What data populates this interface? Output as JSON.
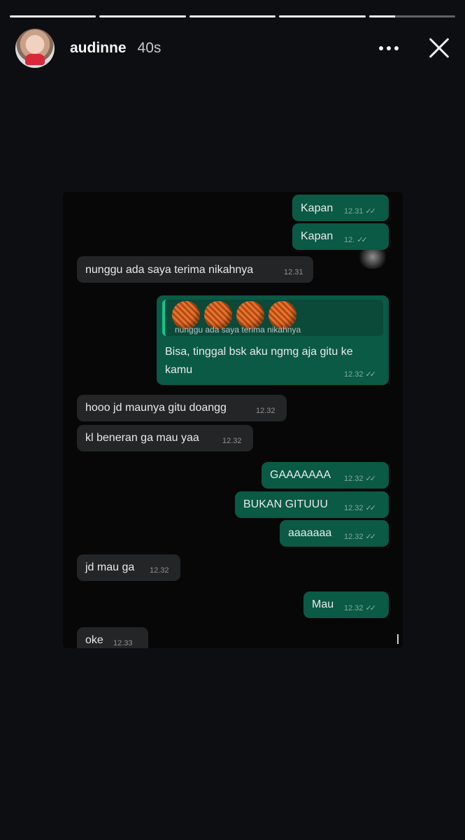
{
  "story": {
    "username": "audinne",
    "time_ago": "40s",
    "more_icon": "more-horizontal-icon",
    "close_icon": "close-icon",
    "progress": [
      1,
      1,
      1,
      1,
      0.3
    ]
  },
  "chat": {
    "messages": [
      {
        "dir": "out",
        "text": "Kapan",
        "time": "12.31",
        "status": "read"
      },
      {
        "dir": "out",
        "text": "Kapan",
        "time": "12.",
        "status": "read"
      },
      {
        "dir": "in",
        "text": "nunggu ada saya terima nikahnya",
        "time": "12.31"
      },
      {
        "dir": "out",
        "quote_text": "nunggu ada saya terima nikahnya",
        "quote_sticker": "yarn-ball-emoji",
        "text_line1": "Bisa, tinggal bsk aku ngmg aja gitu ke",
        "text_line2": "kamu",
        "time": "12.32",
        "status": "read"
      },
      {
        "dir": "in",
        "text": "hooo jd maunya gitu doangg",
        "time": "12.32"
      },
      {
        "dir": "in",
        "text": "kl beneran ga mau yaa",
        "time": "12.32"
      },
      {
        "dir": "out",
        "text": "GAAAAAAA",
        "time": "12.32",
        "status": "read"
      },
      {
        "dir": "out",
        "text": "BUKAN GITUUU",
        "time": "12.32",
        "status": "read"
      },
      {
        "dir": "out",
        "text": "aaaaaaa",
        "time": "12.32",
        "status": "read"
      },
      {
        "dir": "in",
        "text": "jd mau ga",
        "time": "12.32"
      },
      {
        "dir": "out",
        "text": "Mau",
        "time": "12.32",
        "status": "read"
      },
      {
        "dir": "in",
        "text": "oke",
        "time": "12.33"
      }
    ]
  },
  "colors": {
    "background": "#0d0e12",
    "incoming_bubble": "#232526",
    "outgoing_bubble": "#0a5a45",
    "reply_accent": "#18c28a"
  }
}
